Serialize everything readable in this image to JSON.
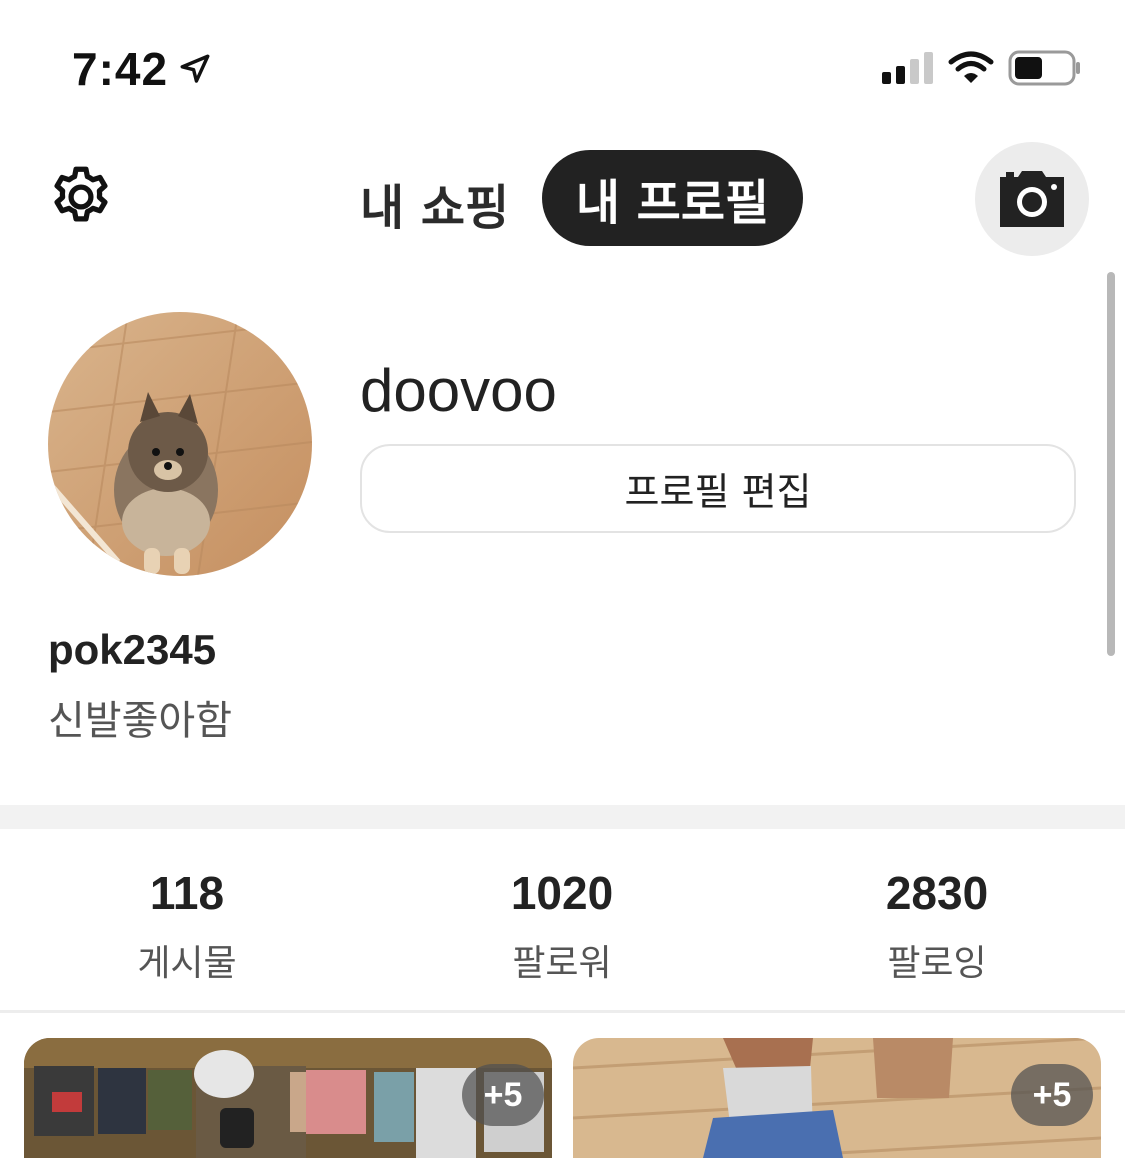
{
  "status_bar": {
    "time": "7:42",
    "icons": [
      "location-arrow-icon",
      "signal-icon",
      "wifi-icon",
      "battery-icon"
    ],
    "battery_level": 0.5
  },
  "header": {
    "settings_icon": "gear-icon",
    "tabs": [
      {
        "label": "내 쇼핑",
        "active": false
      },
      {
        "label": "내 프로필",
        "active": true
      }
    ],
    "camera_icon": "camera-icon"
  },
  "profile": {
    "display_name": "doovoo",
    "edit_button_label": "프로필 편집",
    "username": "pok2345",
    "bio": "신발좋아함"
  },
  "stats": [
    {
      "value": "118",
      "label": "게시물"
    },
    {
      "value": "1020",
      "label": "팔로워"
    },
    {
      "value": "2830",
      "label": "팔로잉"
    }
  ],
  "posts": [
    {
      "badge": "+5"
    },
    {
      "badge": "+5"
    }
  ],
  "colors": {
    "accent_dark": "#222222",
    "background": "#ffffff",
    "muted_text": "#555555"
  }
}
